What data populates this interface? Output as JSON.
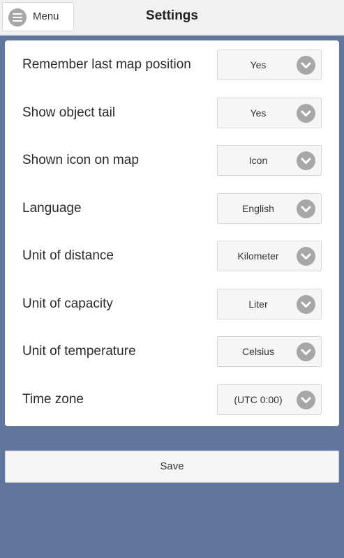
{
  "header": {
    "menu_label": "Menu",
    "title": "Settings"
  },
  "settings": [
    {
      "label": "Remember last map position",
      "value": "Yes"
    },
    {
      "label": "Show object tail",
      "value": "Yes"
    },
    {
      "label": "Shown icon on map",
      "value": "Icon"
    },
    {
      "label": "Language",
      "value": "English"
    },
    {
      "label": "Unit of distance",
      "value": "Kilometer"
    },
    {
      "label": "Unit of capacity",
      "value": "Liter"
    },
    {
      "label": "Unit of temperature",
      "value": "Celsius"
    },
    {
      "label": "Time zone",
      "value": "(UTC 0:00)"
    }
  ],
  "save_label": "Save",
  "colors": {
    "background": "#62759c",
    "header": "#f1f1f1",
    "panel": "#ffffff",
    "chevron_circle": "#a7a7a7"
  },
  "icons": {
    "menu": "hamburger-menu-icon",
    "dropdown": "chevron-down-icon"
  }
}
